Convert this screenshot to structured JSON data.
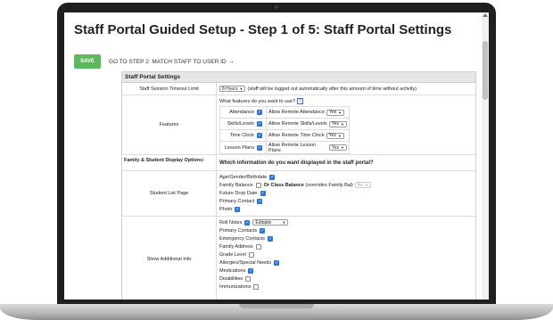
{
  "page": {
    "title": "Staff Portal Guided Setup - Step 1 of 5: Staff Portal Settings",
    "save_label": "SAVE",
    "next_label": "GO TO STEP 2: MATCH STAFF TO USER ID",
    "next_arrow": "→"
  },
  "panel": {
    "header": "Staff Portal Settings",
    "timeout": {
      "label": "Staff Session Timeout Limit",
      "value": "8 Hours",
      "note": "(staff will be logged out automatically after this amount of time without activity)"
    },
    "features": {
      "label": "Features",
      "question": "What features do you want to use?",
      "help": "?",
      "items": [
        {
          "name": "Attendance",
          "remote": "Allow Remote Attendance",
          "value": "Yes"
        },
        {
          "name": "Skills/Levels",
          "remote": "Allow Remote Skills/Levels",
          "value": "Yes"
        },
        {
          "name": "Time Clock",
          "remote": "Allow Remote Time Clock",
          "value": "Yes"
        },
        {
          "name": "Lesson Plans",
          "remote": "Allow Remote Lesson Plans",
          "value": "Yes"
        }
      ]
    },
    "display": {
      "label": "Family & Student Display Options:",
      "question": "Which information do you want displayed in the staff portal?"
    },
    "student_list": {
      "label": "Student List Page",
      "age": "Age/Gender/Birthdate",
      "family_balance": "Family Balance",
      "or_class": "Or Class Balance",
      "overrides": "(overrides Family Bal)",
      "override_value": "No",
      "future_drop": "Future Drop Date",
      "primary_contact": "Primary Contact",
      "photo": "Photo"
    },
    "additional": {
      "label": "Show Additional Info",
      "roll_notes": "Roll Notes",
      "roll_value": "Editable",
      "primary_contacts": "Primary Contacts",
      "emergency": "Emergency Contacts",
      "family_address": "Family Address",
      "grade": "Grade Level",
      "allergies": "Allergies/Special Needs",
      "medications": "Medications",
      "disabilities": "Disabilities",
      "immunizations": "Immunizations"
    }
  },
  "colors": {
    "save": "#5cb85c",
    "checkbox": "#2b74d8"
  }
}
